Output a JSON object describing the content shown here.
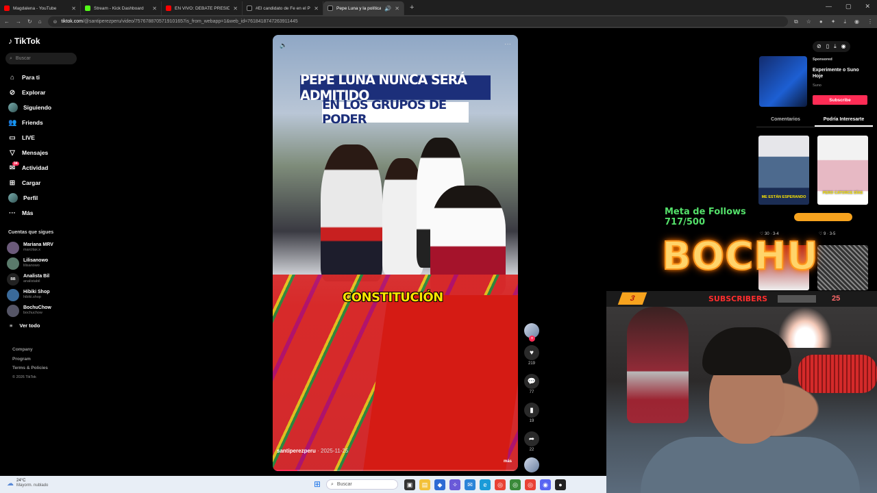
{
  "browser": {
    "tabs": [
      {
        "title": "Magdalena - YouTube",
        "color": "#ff0000"
      },
      {
        "title": "Stream - Kick Dashboard",
        "color": "#53fc18"
      },
      {
        "title": "EN VIVO: DEBATE PRESIDENCI",
        "color": "#ff0000"
      },
      {
        "title": "#El candidato de Fe en el P",
        "color": "#ffffff"
      },
      {
        "title": "Pepe Luna y la política peru",
        "color": "#ffffff",
        "active": true
      }
    ],
    "url_host": "tiktok.com",
    "url_path": "/@santiperezperu/video/7576788705719101657is_from_webapp=1&web_id=7618418747263911445"
  },
  "tiktok": {
    "logo": "TikTok",
    "search_placeholder": "Buscar",
    "nav": [
      {
        "label": "Para ti",
        "icon": "home-icon"
      },
      {
        "label": "Explorar",
        "icon": "compass-icon"
      },
      {
        "label": "Siguiendo",
        "icon": "following-avatar"
      },
      {
        "label": "Friends",
        "icon": "friends-icon"
      },
      {
        "label": "LIVE",
        "icon": "live-icon"
      },
      {
        "label": "Mensajes",
        "icon": "messages-icon"
      },
      {
        "label": "Actividad",
        "icon": "activity-icon",
        "badge": "34"
      },
      {
        "label": "Cargar",
        "icon": "upload-icon"
      },
      {
        "label": "Perfil",
        "icon": "profile-avatar"
      },
      {
        "label": "Más",
        "icon": "more-icon"
      }
    ],
    "following_title": "Cuentas que sigues",
    "following": [
      {
        "name": "Mariana MRV",
        "handle": "marcitax.x"
      },
      {
        "name": "Lilisanowo",
        "handle": "lilisanowo"
      },
      {
        "name": "Analista Bil",
        "handle": "analistabil",
        "initials": "BB"
      },
      {
        "name": "Hibiki Shop",
        "handle": "hibiki.shop"
      },
      {
        "name": "BochuChow",
        "handle": "bochuchow"
      }
    ],
    "see_all": "Ver todo",
    "footer": [
      "Company",
      "Program",
      "Terms & Policies"
    ],
    "copyright": "© 2026 TikTok"
  },
  "video": {
    "caption_top": "PEPE LUNA NUNCA SERÁ ADMITIDO",
    "caption_mid": "EN LOS GRUPOS DE PODER",
    "caption_bottom": "CONSTITUCIÓN",
    "author": "santiperezperu",
    "date": " · 2025-11-25",
    "more": "más",
    "progress_fraction": 0.1,
    "likes": "219",
    "comments": "77",
    "saves": "19",
    "shares": "22"
  },
  "right": {
    "ad_sponsored": "Sponsored",
    "ad_title": "Experimente o Suno Hoje",
    "ad_brand": "Suno",
    "ad_button": "Subscribe",
    "tab_comments": "Comentarios",
    "tab_interesting": "Podría Interesarte",
    "thumb1_caption": "ME ESTÁN ESPERANDO",
    "thumb2_caption": "PERO CATORCE DÍAS",
    "thumb1_stats": "30 · 3-4",
    "thumb2_stats": "9 · 3-5"
  },
  "stream": {
    "goal_text": "Meta de Follows 717/500",
    "goal_fraction": 1.0,
    "logo_text": "BOCHU",
    "subs_left": "3",
    "subs_label": "SUBSCRIBERS",
    "subs_right": "25"
  },
  "taskbar": {
    "temp": "24°C",
    "weather": "Mayorm. nublado",
    "search": "Buscar"
  }
}
